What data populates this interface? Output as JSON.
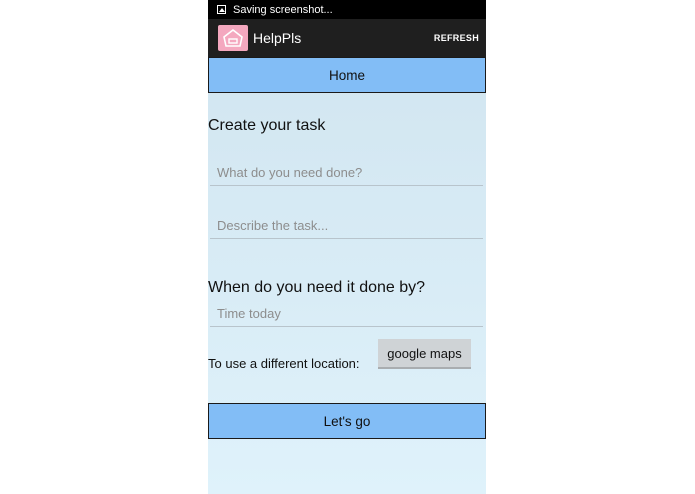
{
  "status_bar": {
    "text": "Saving screenshot...",
    "icon": "image-icon"
  },
  "action_bar": {
    "title": "HelpPls",
    "refresh_label": "REFRESH",
    "icon": "house-icon",
    "icon_color": "#f4a8bf"
  },
  "home_button": {
    "label": "Home"
  },
  "create_heading": "Create your task",
  "task_field": {
    "placeholder": "What do you need done?",
    "value": ""
  },
  "description_field": {
    "placeholder": "Describe the task...",
    "value": ""
  },
  "deadline_heading": "When do you need it done by?",
  "time_field": {
    "placeholder": "Time today",
    "value": ""
  },
  "location": {
    "label": "To use a different location:",
    "maps_button": "google maps"
  },
  "go_button": {
    "label": "Let's go"
  },
  "colors": {
    "button": "#82bdf6",
    "background": "#d6eaf4",
    "action_bar": "#1f1f1f"
  }
}
